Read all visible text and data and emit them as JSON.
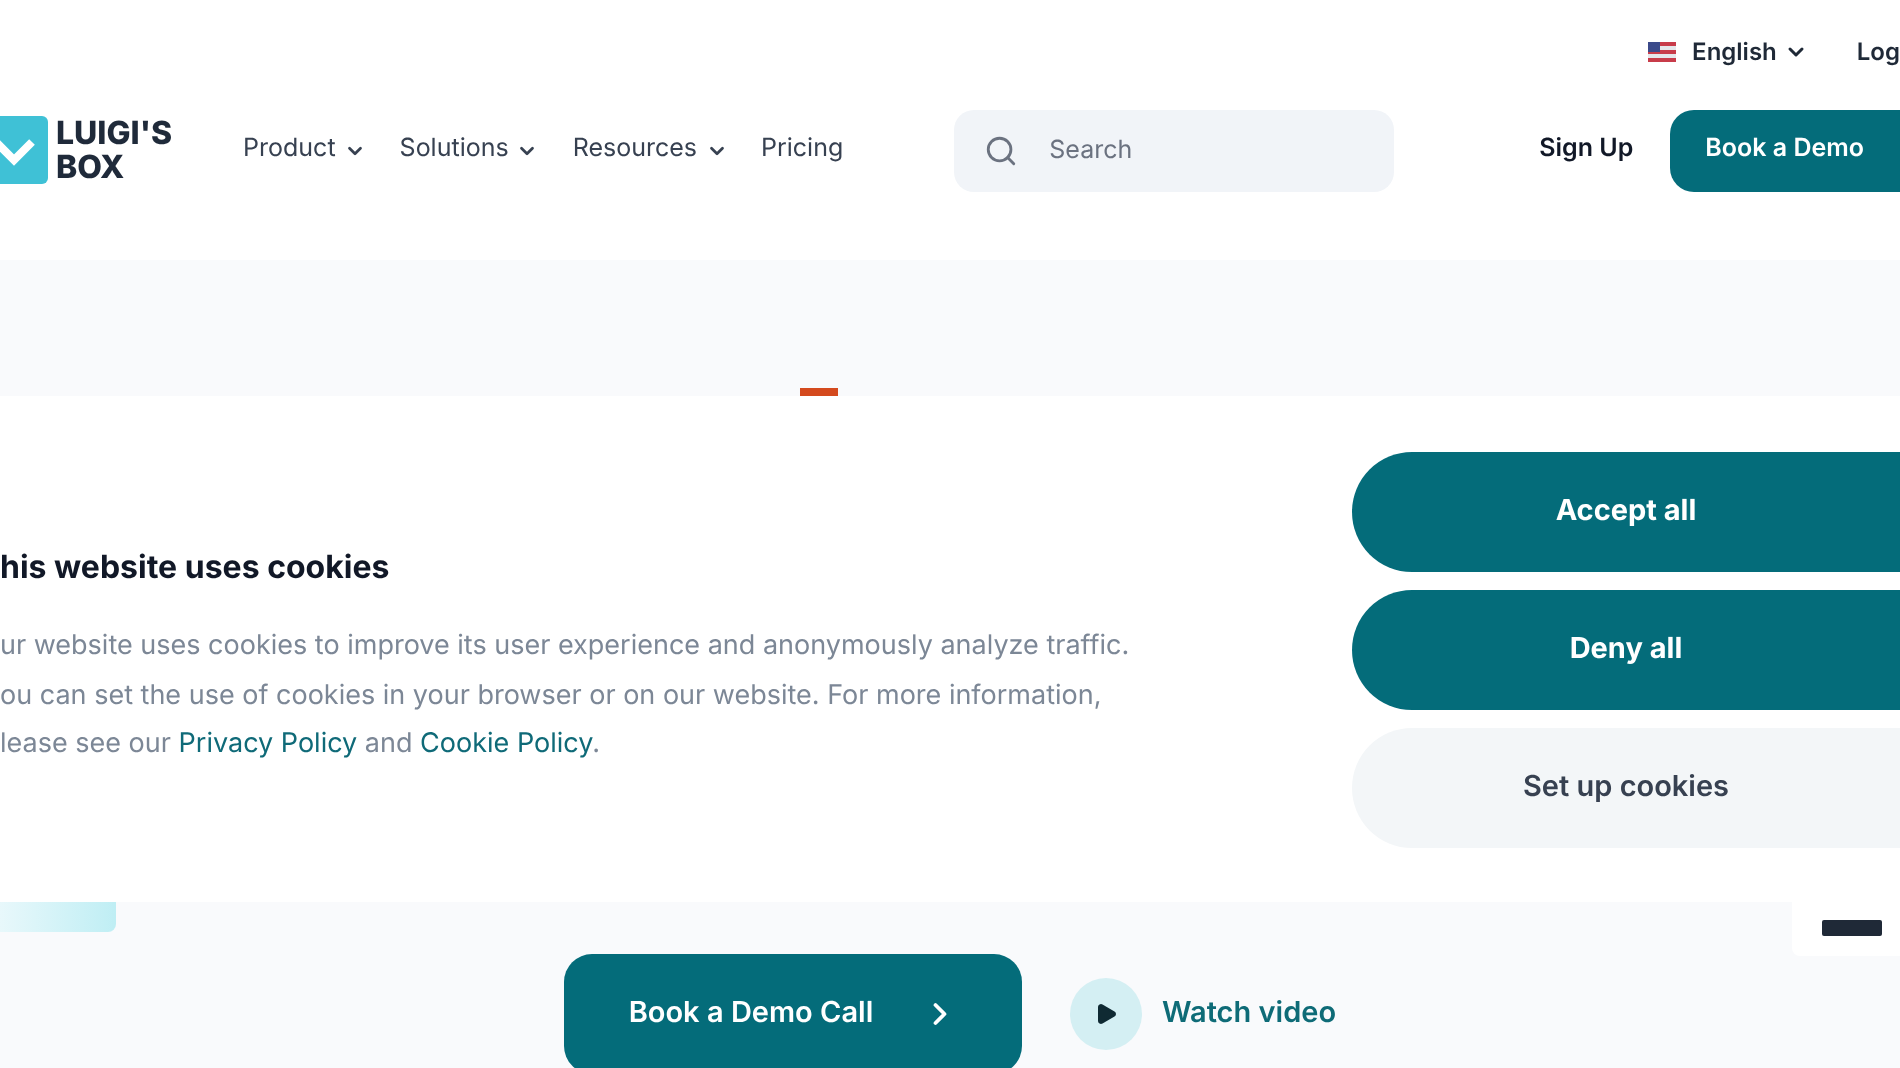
{
  "top_bar": {
    "language": "English",
    "login": "Log"
  },
  "header": {
    "logo": {
      "line1": "LUIGI'S",
      "line2": "BOX"
    },
    "nav": [
      {
        "label": "Product",
        "dropdown": true
      },
      {
        "label": "Solutions",
        "dropdown": true
      },
      {
        "label": "Resources",
        "dropdown": true
      },
      {
        "label": "Pricing",
        "dropdown": false
      }
    ],
    "search": {
      "placeholder": "Search"
    },
    "sign_up": "Sign Up",
    "book_demo": "Book a Demo"
  },
  "cookie_banner": {
    "title": "his website uses cookies",
    "lines": [
      "ur website uses cookies to improve its user experience and anonymously analyze traffic.",
      "ou can set the use of cookies in your browser or on our website. For more information,"
    ],
    "last_line": [
      {
        "kind": "text",
        "text": "lease see our "
      },
      {
        "kind": "link",
        "text": "Privacy Policy"
      },
      {
        "kind": "text",
        "text": " and "
      },
      {
        "kind": "link",
        "text": "Cookie Policy"
      },
      {
        "kind": "text",
        "text": "."
      }
    ],
    "buttons": [
      {
        "label": "Accept all",
        "kind": "primary"
      },
      {
        "label": "Deny all",
        "kind": "primary"
      },
      {
        "label": "Set up cookies",
        "kind": "secondary"
      }
    ]
  },
  "hero": {
    "cta": "Book a Demo Call",
    "video": "Watch video"
  }
}
